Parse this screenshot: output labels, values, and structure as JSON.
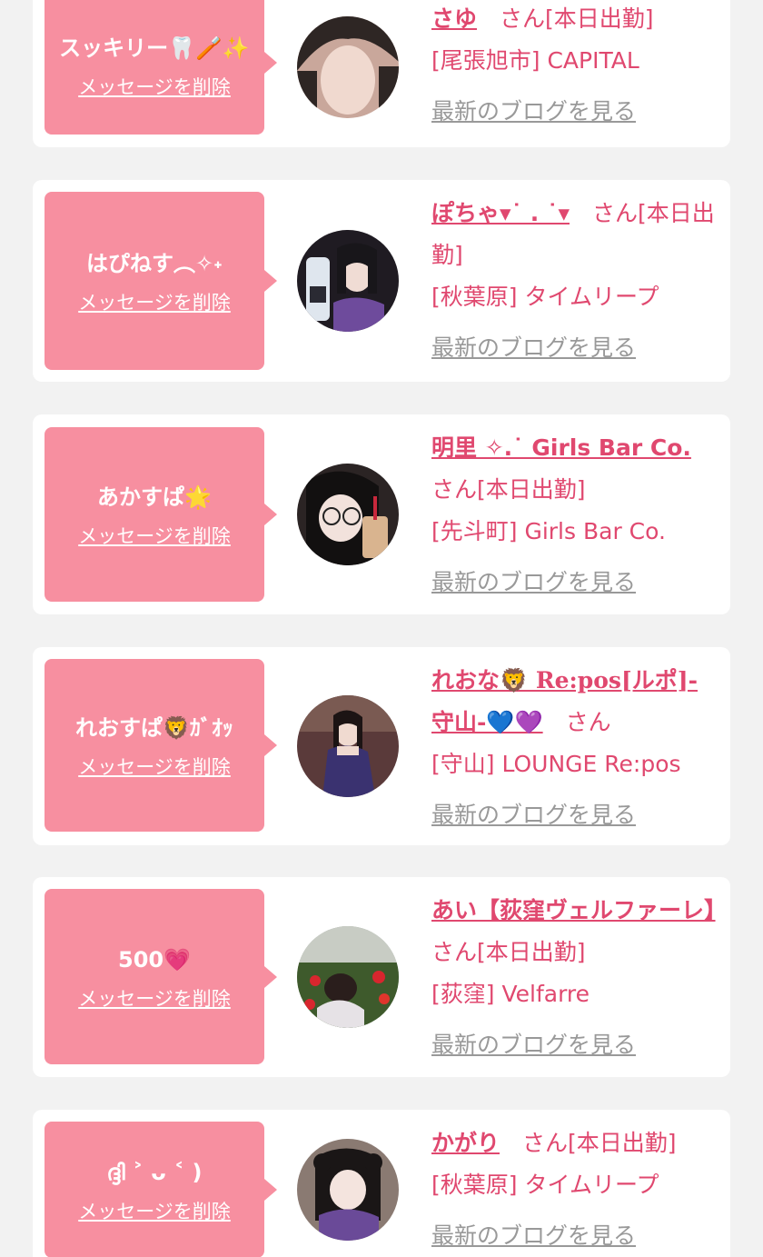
{
  "labels": {
    "delete": "メッセージを削除",
    "blog": "最新のブログを見る"
  },
  "colors": {
    "background": "#f2f2f2",
    "bubble": "#f78fa0",
    "accent": "#e0486f",
    "muted_link": "#999999"
  },
  "entries": [
    {
      "message": "スッキリー🦷🪥✨",
      "name": "さゆ",
      "suffix": "さん[本日出勤]",
      "location": "[尾張旭市] CAPITAL"
    },
    {
      "message": "はぴねす︵✧˖",
      "name": "ぽちゃ▾˙ . ˙▾",
      "suffix": "さん[本日出勤]",
      "location": "[秋葉原] タイムリープ"
    },
    {
      "message": "あかすぱ🌟",
      "name": "明里 ✧.˙ Girls Bar Co.",
      "suffix": "さん[本日出勤]",
      "location": "[先斗町] Girls Bar Co."
    },
    {
      "message": "れおすぱ🦁ｶﾞｵｯ",
      "name": "れおな🦁 Re:pos[ルポ]-守山-💙💜",
      "suffix": "さん",
      "location": "[守山] LOUNGE Re:pos"
    },
    {
      "message": "500💗",
      "name": "あい【荻窪ヴェルファーレ】",
      "suffix": "さん[本日出勤]",
      "location": "[荻窪] Velfarre"
    },
    {
      "message": "ദ്ദി ˃ ᴗ ˂ )",
      "name": "かがり",
      "suffix": "さん[本日出勤]",
      "location": "[秋葉原] タイムリープ"
    }
  ]
}
